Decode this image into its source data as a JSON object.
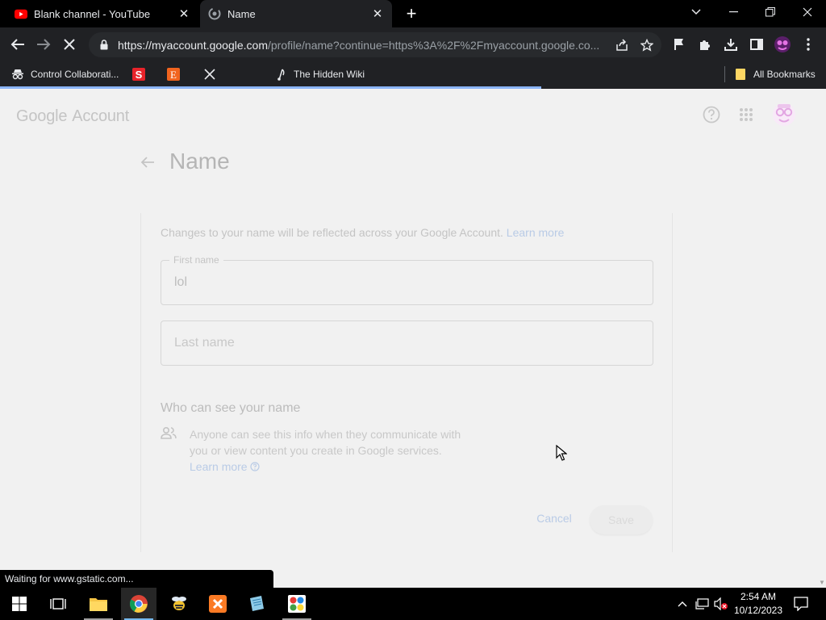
{
  "browser": {
    "tabs": [
      {
        "title": "Blank channel - YouTube",
        "active": false,
        "icon": "youtube-icon"
      },
      {
        "title": "Name",
        "active": true,
        "icon": "chrome-sync-icon"
      }
    ],
    "url_host": "https://myaccount.google.com",
    "url_rest": "/profile/name?continue=https%3A%2F%2Fmyaccount.google.co...",
    "page_load_progress": 0.655,
    "bookmarks": [
      {
        "label": "Control Collaborati...",
        "icon": "incognito-icon"
      },
      {
        "label": "",
        "icon": "s-logo-icon"
      },
      {
        "label": "",
        "icon": "e-logo-icon"
      },
      {
        "label": "",
        "icon": "x-logo-icon"
      },
      {
        "label": "The Hidden Wiki",
        "icon": "wiki-icon"
      }
    ],
    "all_bookmarks_label": "All Bookmarks",
    "status_text": "Waiting for www.gstatic.com..."
  },
  "page": {
    "logo_google": "Google",
    "logo_account": "Account",
    "title": "Name",
    "description": "Changes to your name will be reflected across your Google Account.",
    "description_link": "Learn more",
    "first_name_label": "First name",
    "first_name_value": "lol",
    "last_name_placeholder": "Last name",
    "who_title": "Who can see your name",
    "who_text": "Anyone can see this info when they communicate with you or view content you create in Google services.",
    "who_link": "Learn more",
    "cancel_label": "Cancel",
    "save_label": "Save"
  },
  "taskbar": {
    "time": "2:54 AM",
    "date": "10/12/2023",
    "apps": [
      "windows-start",
      "task-view",
      "file-explorer",
      "chrome",
      "bee-app",
      "xampp",
      "notepad-app",
      "paint-app"
    ]
  },
  "colors": {
    "accent_blue": "#8ab4f8",
    "link_faded": "#b9cbe6",
    "youtube_red": "#ff0000"
  }
}
